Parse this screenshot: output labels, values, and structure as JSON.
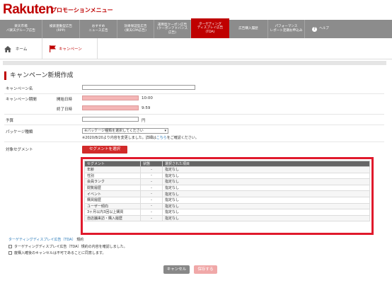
{
  "header": {
    "logo": "Rakuten",
    "title": "プロモーションメニュー"
  },
  "nav": {
    "items": [
      {
        "label": "楽天市場\nバ楽天グループ広告"
      },
      {
        "label": "検索連動型広告\n(RPP)"
      },
      {
        "label": "おすすめ\nニュース広告"
      },
      {
        "label": "効果保証型広告\n(楽天CPA広告)"
      },
      {
        "label": "運用型クーポン広告\n(クーポンアドバンス\n広告)"
      },
      {
        "label": "ターゲティング\nディスプレイ広告\n(TDA)"
      },
      {
        "label": "広告購入履歴"
      },
      {
        "label": "パフォーマンス\nレポート定期お申込み"
      },
      {
        "label": "ヘルプ"
      }
    ]
  },
  "breadcrumb": {
    "home": "ホーム",
    "campaign": "キャンペーン"
  },
  "page": {
    "title": "キャンペーン新規作成"
  },
  "form": {
    "campaign_name_label": "キャンペーン名",
    "period_label": "キャンペーン期間",
    "start_label": "開始日時",
    "start_time": "10:00",
    "end_label": "終了日時",
    "end_time": "9:59",
    "budget_label": "予算",
    "budget_unit": "円",
    "package_label": "パッケージ種類",
    "package_select": "※パッケージ種類を選択してください",
    "package_note_pre": "※2020/8/20より内容を変更しました。詳細は",
    "package_note_link": "こちら",
    "package_note_post": "をご確認ください。",
    "segment_label": "対象セグメント",
    "segment_button": "セグメントを選択"
  },
  "segment_table": {
    "headers": [
      "セグメント",
      "状態",
      "選択された項目"
    ],
    "rows": [
      [
        "年齢",
        "-",
        "指定なし"
      ],
      [
        "性別",
        "-",
        "指定なし"
      ],
      [
        "会員ランク",
        "-",
        "指定なし"
      ],
      [
        "閲覧履歴",
        "-",
        "指定なし"
      ],
      [
        "イベント",
        "-",
        "指定なし"
      ],
      [
        "購買履歴",
        "-",
        "指定なし"
      ],
      [
        "ユーザー傾向",
        "-",
        "指定なし"
      ],
      [
        "3ヶ月以内3回以上購買",
        "-",
        "指定なし"
      ],
      [
        "自店舗来訪・購入履歴",
        "-",
        "指定なし"
      ]
    ]
  },
  "terms": {
    "link": "ターゲティングディスプレイ広告（TDA）",
    "suffix": "規約",
    "check1": "ターゲティングディスプレイ広告（TDA）規約の内容を確認しました。",
    "check2": "废購入確後のキャンセルは不可であることに同意します。"
  },
  "buttons": {
    "cancel": "キャンセル",
    "save": "保存する"
  },
  "colors": {
    "brand_red": "#bf0000",
    "nav_gray": "#8c8c8c",
    "highlight_red": "#e01a2c"
  }
}
